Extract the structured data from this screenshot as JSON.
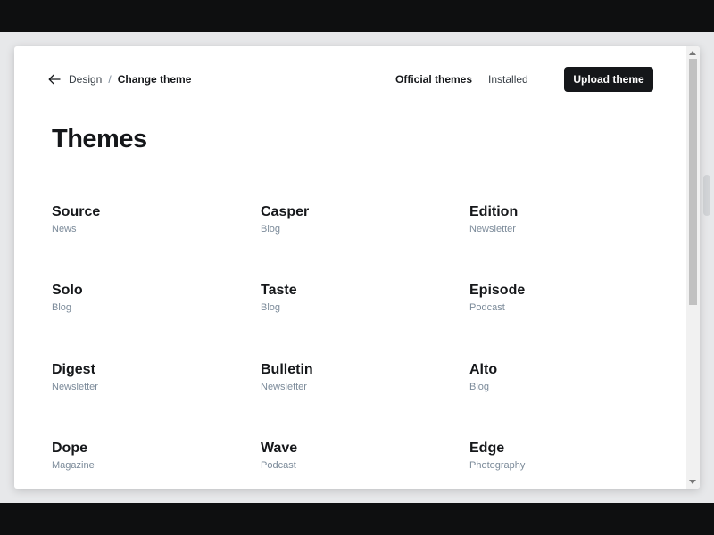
{
  "breadcrumb": {
    "parent": "Design",
    "separator": "/",
    "current": "Change theme"
  },
  "tabs": {
    "official": "Official themes",
    "installed": "Installed"
  },
  "actions": {
    "upload_label": "Upload theme"
  },
  "page": {
    "title": "Themes"
  },
  "themes": [
    {
      "name": "Source",
      "category": "News"
    },
    {
      "name": "Casper",
      "category": "Blog"
    },
    {
      "name": "Edition",
      "category": "Newsletter"
    },
    {
      "name": "Solo",
      "category": "Blog"
    },
    {
      "name": "Taste",
      "category": "Blog"
    },
    {
      "name": "Episode",
      "category": "Podcast"
    },
    {
      "name": "Digest",
      "category": "Newsletter"
    },
    {
      "name": "Bulletin",
      "category": "Newsletter"
    },
    {
      "name": "Alto",
      "category": "Blog"
    },
    {
      "name": "Dope",
      "category": "Magazine"
    },
    {
      "name": "Wave",
      "category": "Podcast"
    },
    {
      "name": "Edge",
      "category": "Photography"
    }
  ],
  "colors": {
    "text_primary": "#15171a",
    "text_muted": "#7c8b9a",
    "button_bg": "#15171a",
    "button_text": "#ffffff"
  }
}
